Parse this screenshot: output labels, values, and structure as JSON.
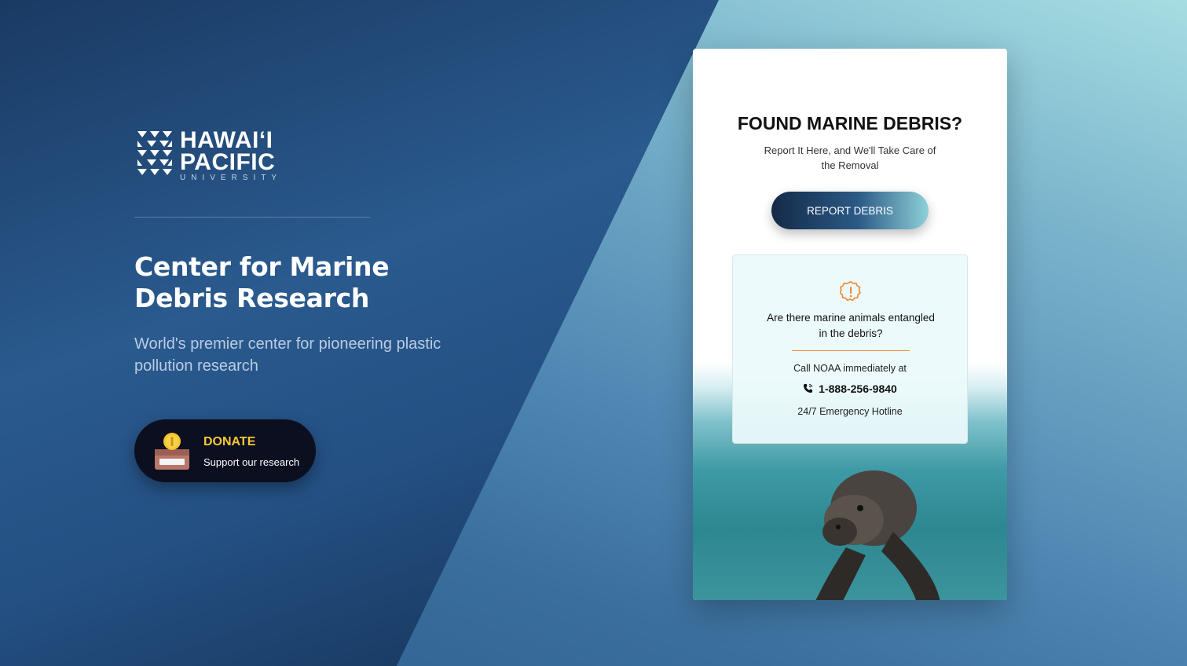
{
  "brand": {
    "logo_line1": "HAWAIʻI",
    "logo_line2": "PACIFIC",
    "logo_line3": "UNIVERSITY"
  },
  "hero": {
    "title": "Center for Marine Debris Research",
    "subtitle": "World's premier center for pioneering plastic pollution research"
  },
  "donate": {
    "label": "DONATE",
    "sub": "Support our research"
  },
  "card": {
    "heading": "FOUND MARINE DEBRIS?",
    "subheading": "Report It Here, and We'll Take Care of the Removal",
    "button": "REPORT DEBRIS",
    "alert": {
      "question": "Are there marine animals entangled in the debris?",
      "call": "Call NOAA immediately at",
      "phone": "1-888-256-9840",
      "hotline": "24/7 Emergency Hotline"
    }
  },
  "colors": {
    "accent_gold": "#f7c83b",
    "alert_orange": "#f08c38",
    "dark_navy": "#0b0f1f"
  }
}
